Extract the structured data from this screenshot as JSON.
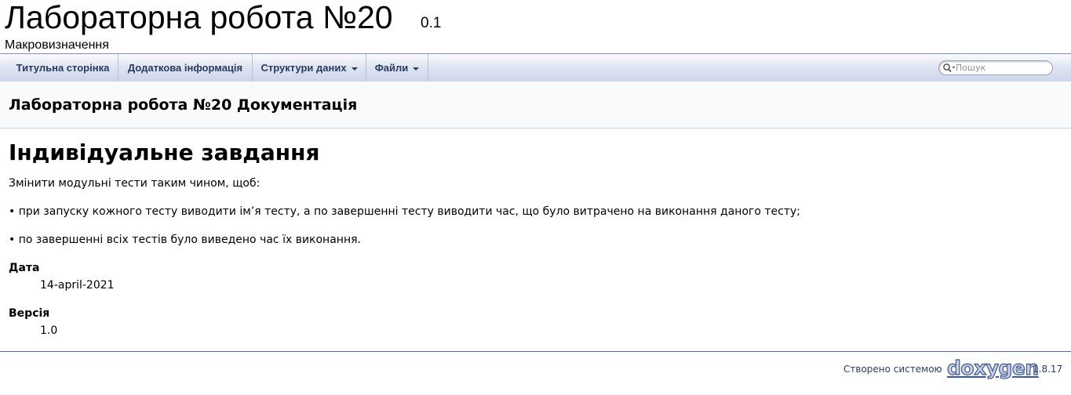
{
  "project": {
    "name": "Лабораторна робота №20",
    "number": "0.1",
    "brief": "Макровизначення"
  },
  "nav": {
    "tabs": [
      {
        "label": "Титульна сторінка"
      },
      {
        "label": "Додаткова інформація"
      },
      {
        "label": "Структури даних"
      },
      {
        "label": "Файли"
      }
    ],
    "search_placeholder": "Пошук"
  },
  "page": {
    "title": "Лабораторна робота №20 Документація",
    "heading": "Індивідуальне завдання",
    "paragraphs": [
      "Змінити модульні тести таким чином, щоб:",
      "• при запуску кожного тесту виводити ім’я тесту, а по завершенні тесту виводити час, що було витрачено на виконання даного тесту;",
      "• по завершенні всіх тестів було виведено час їх виконання."
    ],
    "fields": [
      {
        "label": "Дата",
        "value": "14-april-2021"
      },
      {
        "label": "Версія",
        "value": "1.0"
      }
    ]
  },
  "footer": {
    "generated_by": "Створено системою",
    "logo": "doxygen",
    "version": "1.8.17"
  },
  "colors": {
    "nav_text": "#283a5d",
    "nav_border": "#b4c0de",
    "footer_line": "#4a6aaa"
  }
}
